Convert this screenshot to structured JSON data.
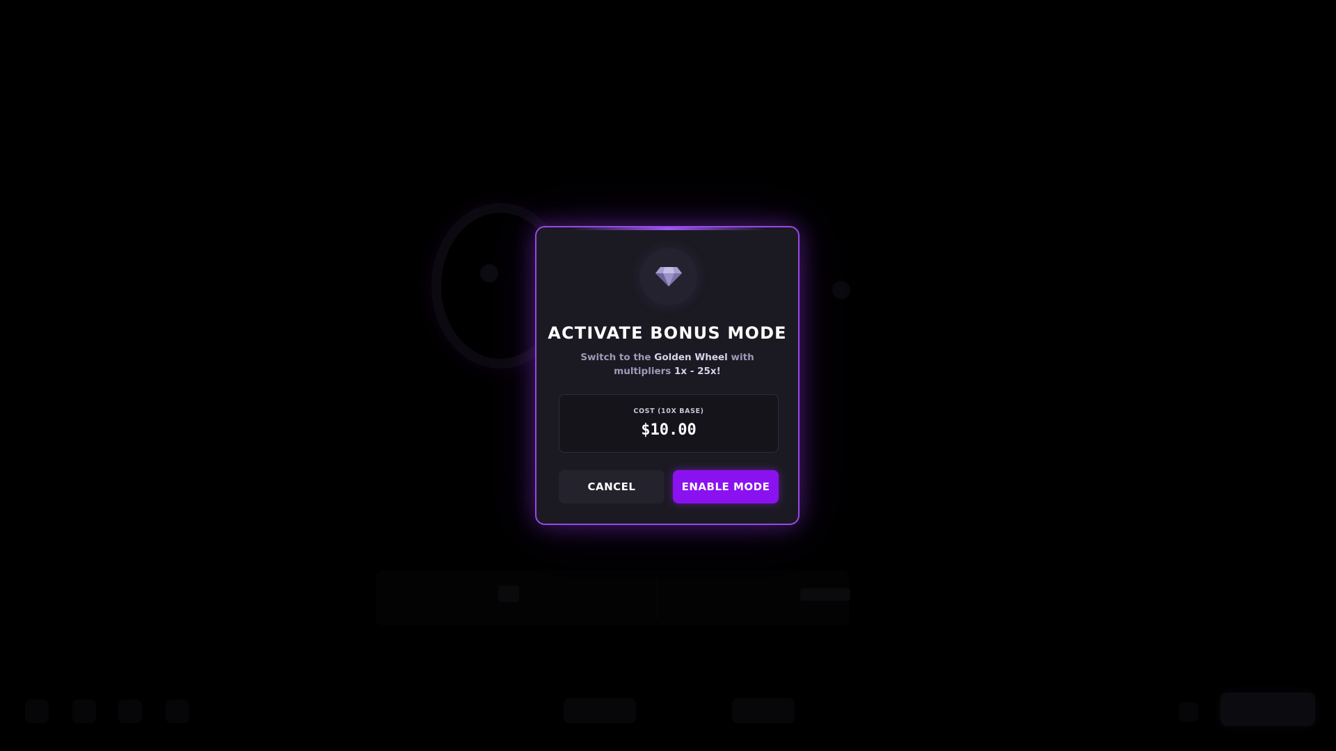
{
  "modal": {
    "icon": "diamond-icon",
    "title": "ACTIVATE BONUS MODE",
    "description": {
      "prefix": "Switch to the ",
      "highlight_1": "Golden Wheel",
      "middle": " with multipliers ",
      "highlight_2": "1x - 25x",
      "suffix": "!"
    },
    "cost": {
      "label": "COST (10X BASE)",
      "value": "$10.00"
    },
    "buttons": {
      "cancel_label": "CANCEL",
      "enable_label": "ENABLE MODE"
    }
  },
  "colors": {
    "background": "#000000",
    "modal_background": "#1b1a22",
    "modal_border": "#9a48ea",
    "accent": "#8b12f0",
    "cancel_button": "#24222d",
    "description_text": "#9f9ab8",
    "gem": "#8e84b8"
  }
}
